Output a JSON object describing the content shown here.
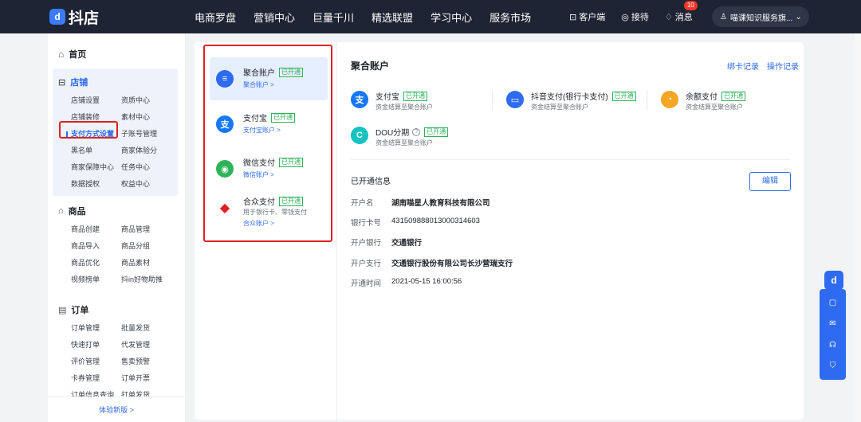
{
  "topbar": {
    "logo_mark": "d",
    "logo_text": "抖店",
    "nav": [
      "电商罗盘",
      "营销中心",
      "巨量千川",
      "精选联盟",
      "学习中心",
      "服务市场"
    ],
    "client_label": "客户端",
    "reception_label": "接待",
    "messages_label": "消息",
    "messages_badge": "10",
    "user_name": "喵课知识服务旗..."
  },
  "sidebar": {
    "home": "首页",
    "store": {
      "title": "店铺",
      "items": [
        "店铺设置",
        "资质中心",
        "店铺装修",
        "素材中心",
        "支付方式设置",
        "子账号管理",
        "黑名单",
        "商家体验分",
        "商家保障中心",
        "任务中心",
        "数据授权",
        "权益中心"
      ]
    },
    "goods": {
      "title": "商品",
      "items": [
        "商品创建",
        "商品管理",
        "商品导入",
        "商品分组",
        "商品优化",
        "商品素材",
        "视频榜单",
        "抖in好物助推"
      ]
    },
    "orders": {
      "title": "订单",
      "items": [
        "订单管理",
        "批量发货",
        "快速打单",
        "代发管理",
        "评价管理",
        "售卖预警",
        "卡券管理",
        "订单开票",
        "订单信息查询",
        "打单发货"
      ]
    },
    "trial": "体验新版 >"
  },
  "accounts": [
    {
      "title": "聚合账户",
      "tag": "已开通",
      "link": "聚合账户 >",
      "color": "#2e6bf0",
      "icon": "≡"
    },
    {
      "title": "支付宝",
      "tag": "已开通",
      "link": "支付宝账户 >",
      "color": "#1677ff",
      "icon": "支"
    },
    {
      "title": "微信支付",
      "tag": "已开通",
      "link": "微信账户 >",
      "color": "#2fb35a",
      "icon": "◉"
    },
    {
      "title": "合众支付",
      "tag": "已开通",
      "desc": "用于银行卡、零钱支付",
      "link": "合众账户 >",
      "color": "#e02020",
      "icon": "◆"
    }
  ],
  "detail": {
    "title": "聚合账户",
    "links": [
      "绑卡记录",
      "操作记录"
    ],
    "methods": [
      {
        "title": "支付宝",
        "tag": "已开通",
        "desc": "资金结算至聚合账户",
        "color": "#1677ff",
        "icon": "支"
      },
      {
        "title": "抖音支付(银行卡支付)",
        "tag": "已开通",
        "desc": "资金结算至聚合账户",
        "color": "#2e6bf0",
        "icon": "▭"
      },
      {
        "title": "余额支付",
        "tag": "已开通",
        "desc": "资金结算至聚合账户",
        "color": "#f5a623",
        "icon": "◔"
      },
      {
        "title": "DOU分期",
        "tag": "已开通",
        "desc": "资金结算至聚合账户",
        "color": "#13c2c2",
        "icon": "C"
      }
    ],
    "info_title": "已开通信息",
    "edit": "编辑",
    "rows": [
      {
        "k": "开户名",
        "v": "湖南喵星人教育科技有限公司"
      },
      {
        "k": "银行卡号",
        "v": "431509888013000314603"
      },
      {
        "k": "开户银行",
        "v": "交通银行"
      },
      {
        "k": "开户支行",
        "v": "交通银行股份有限公司长沙营瑞支行"
      },
      {
        "k": "开通时间",
        "v": "2021-05-15 16:00:56"
      }
    ]
  },
  "float": {
    "logo": "d"
  }
}
